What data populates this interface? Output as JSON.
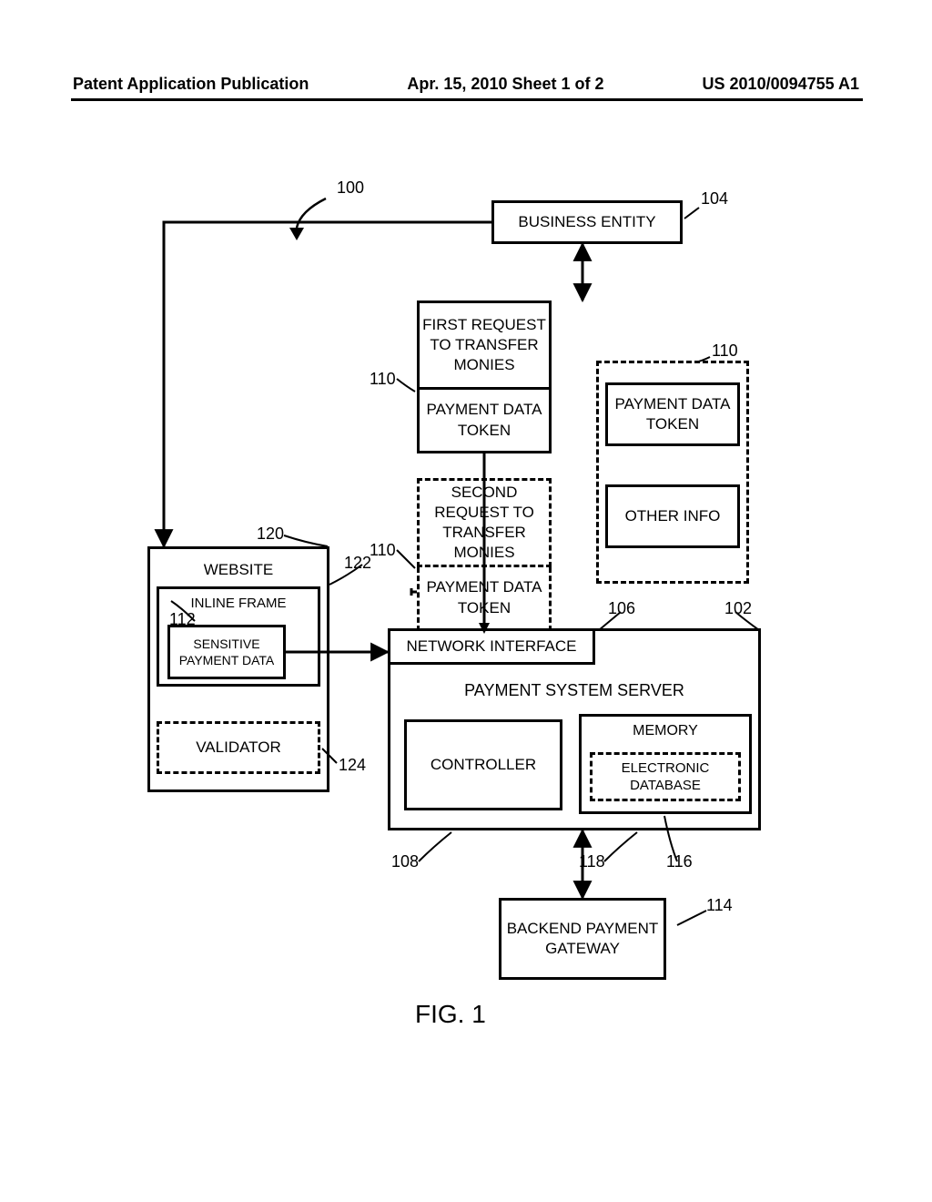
{
  "header": {
    "left": "Patent Application Publication",
    "center": "Apr. 15, 2010  Sheet 1 of 2",
    "right": "US 2010/0094755 A1"
  },
  "refs": {
    "r100": "100",
    "r102": "102",
    "r104": "104",
    "r106": "106",
    "r108": "108",
    "r110a": "110",
    "r110b": "110",
    "r110c": "110",
    "r112": "112",
    "r114": "114",
    "r116": "116",
    "r118": "118",
    "r120": "120",
    "r122": "122",
    "r124": "124"
  },
  "boxes": {
    "business_entity": "BUSINESS ENTITY",
    "first_request": "FIRST REQUEST TO TRANSFER MONIES",
    "second_request": "SECOND REQUEST TO TRANSFER MONIES",
    "payment_token": "PAYMENT DATA TOKEN",
    "other_info": "OTHER INFO",
    "website": "WEBSITE",
    "inline_frame": "INLINE FRAME",
    "sensitive": "SENSITIVE PAYMENT DATA",
    "validator": "VALIDATOR",
    "network_interface": "NETWORK INTERFACE",
    "payment_server": "PAYMENT SYSTEM SERVER",
    "controller": "CONTROLLER",
    "memory": "MEMORY",
    "electronic_db": "ELECTRONIC DATABASE",
    "gateway": "BACKEND PAYMENT GATEWAY"
  },
  "figure": "FIG. 1"
}
